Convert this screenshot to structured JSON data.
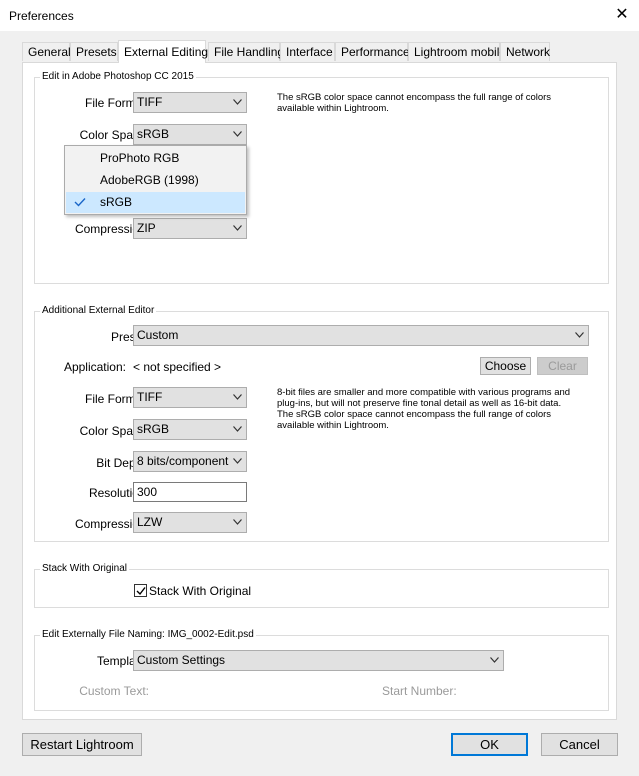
{
  "window": {
    "title": "Preferences",
    "close_glyph": "✕"
  },
  "tabs": [
    "General",
    "Presets",
    "External Editing",
    "File Handling",
    "Interface",
    "Performance",
    "Lightroom mobile",
    "Network"
  ],
  "photoshop": {
    "group_label": "Edit in Adobe Photoshop CC 2015",
    "file_format_label": "File Format:",
    "file_format_value": "TIFF",
    "color_space_label": "Color Space:",
    "color_space_value": "sRGB",
    "compression_label": "Compression:",
    "compression_value": "ZIP",
    "note": "The sRGB color space cannot encompass the full range of colors available within Lightroom."
  },
  "color_space_dropdown": {
    "options": [
      "ProPhoto RGB",
      "AdobeRGB (1998)",
      "sRGB"
    ],
    "selected": "sRGB"
  },
  "additional": {
    "group_label": "Additional External Editor",
    "preset_label": "Preset:",
    "preset_value": "Custom",
    "application_label": "Application:",
    "application_value": "< not specified >",
    "choose_label": "Choose",
    "clear_label": "Clear",
    "file_format_label": "File Format:",
    "file_format_value": "TIFF",
    "color_space_label": "Color Space:",
    "color_space_value": "sRGB",
    "bit_depth_label": "Bit Depth:",
    "bit_depth_value": "8 bits/component",
    "resolution_label": "Resolution:",
    "resolution_value": "300",
    "compression_label": "Compression:",
    "compression_value": "LZW",
    "note": "8-bit files are smaller and more compatible with various programs and plug-ins, but will not preserve fine tonal detail as well as 16-bit data. The sRGB color space cannot encompass the full range of colors available within Lightroom."
  },
  "stack": {
    "group_label": "Stack With Original",
    "checkbox_label": "Stack With Original",
    "checked": true
  },
  "naming": {
    "group_label": "Edit Externally File Naming:",
    "example": "IMG_0002-Edit.psd",
    "template_label": "Template:",
    "template_value": "Custom Settings",
    "custom_text_label": "Custom Text:",
    "start_number_label": "Start Number:"
  },
  "footer": {
    "restart_label": "Restart Lightroom",
    "ok_label": "OK",
    "cancel_label": "Cancel"
  },
  "icons": {
    "combo_arrow": "chevron-down-icon",
    "check": "check-icon",
    "close": "close-icon"
  }
}
